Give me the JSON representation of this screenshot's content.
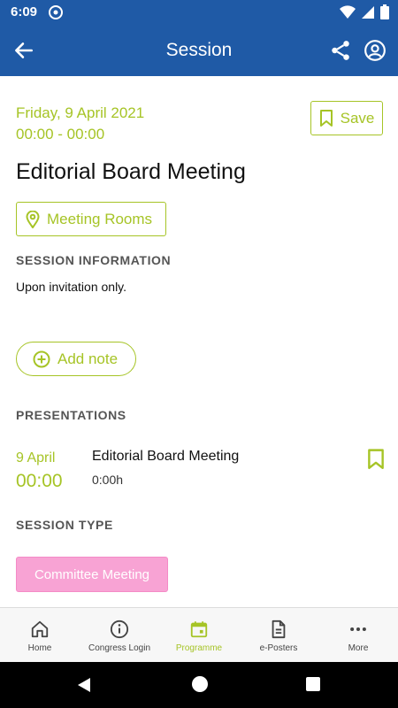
{
  "status_bar": {
    "time": "6:09"
  },
  "app_bar": {
    "title": "Session"
  },
  "session": {
    "date": "Friday, 9 April 2021",
    "time_range": "00:00 - 00:00",
    "save_label": "Save",
    "title": "Editorial Board Meeting",
    "room_label": "Meeting Rooms"
  },
  "session_information": {
    "heading": "SESSION INFORMATION",
    "text": "Upon invitation only."
  },
  "add_note_label": "Add note",
  "presentations": {
    "heading": "PRESENTATIONS",
    "items": [
      {
        "date": "9 April",
        "time": "00:00",
        "title": "Editorial Board Meeting",
        "duration": "0:00h"
      }
    ]
  },
  "session_type": {
    "heading": "SESSION TYPE",
    "label": "Committee Meeting",
    "color": "#f8a3d4"
  },
  "bottom_nav": {
    "items": [
      {
        "label": "Home",
        "icon": "home-icon"
      },
      {
        "label": "Congress Login",
        "icon": "info-icon"
      },
      {
        "label": "Programme",
        "icon": "calendar-icon",
        "active": true
      },
      {
        "label": "e-Posters",
        "icon": "document-icon"
      },
      {
        "label": "More",
        "icon": "more-icon"
      }
    ]
  },
  "colors": {
    "brand_blue": "#1f5aa6",
    "accent_green": "#a6c426"
  }
}
